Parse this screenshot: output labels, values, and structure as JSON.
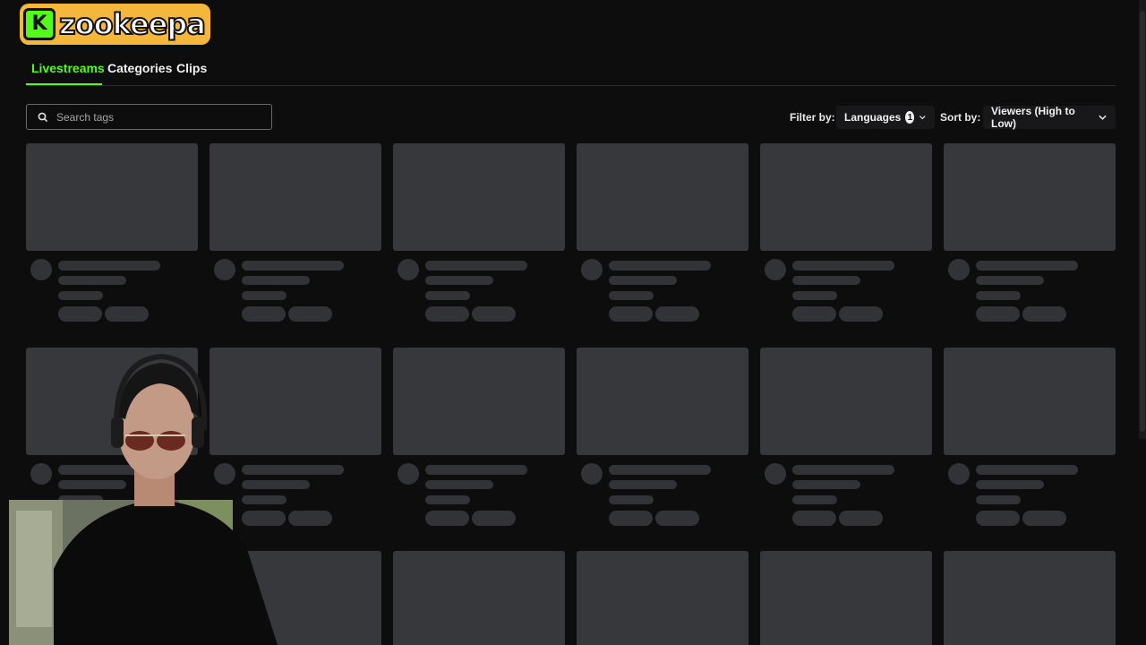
{
  "brand": {
    "name": "zookeepa",
    "mark": "K"
  },
  "tabs": [
    {
      "label": "Livestreams",
      "active": true
    },
    {
      "label": "Categories",
      "active": false
    },
    {
      "label": "Clips",
      "active": false
    }
  ],
  "search": {
    "placeholder": "Search tags",
    "value": ""
  },
  "filter": {
    "label": "Filter by:",
    "languages_label": "Languages",
    "languages_count": "1"
  },
  "sort": {
    "label": "Sort by:",
    "value": "Viewers (High to Low)"
  },
  "colors": {
    "accent": "#53fc18",
    "background": "#0d0d0e",
    "skeleton": "#36383c",
    "logo": "#f4b63b"
  }
}
